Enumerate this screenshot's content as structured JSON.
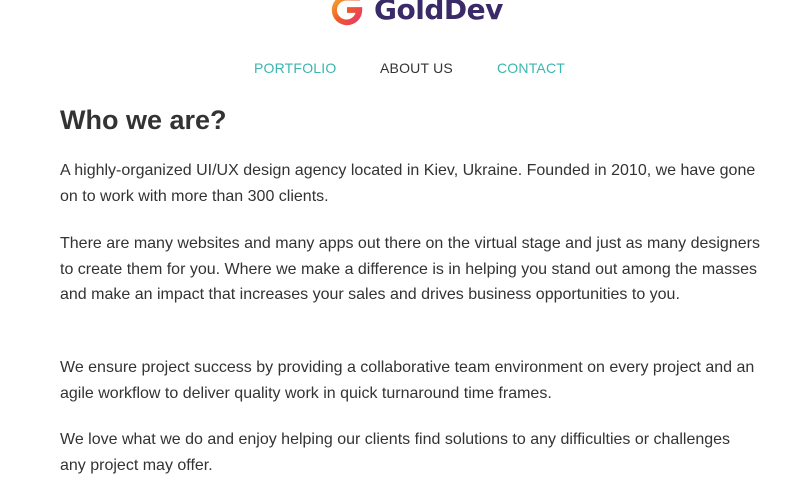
{
  "brand": {
    "name": "GoldDev",
    "logo_icon": "g-logo-mark-icon",
    "colors": {
      "logo_gradient_start": "#f05a28",
      "logo_gradient_mid": "#e8307a",
      "logo_gradient_end": "#f7b733",
      "logo_text": "#3b2a68"
    }
  },
  "nav": {
    "items": [
      {
        "label": "PORTFOLIO",
        "color": "#3bb5b0"
      },
      {
        "label": "ABOUT US",
        "color": "#333333"
      },
      {
        "label": "CONTACT",
        "color": "#3bb5b0"
      }
    ]
  },
  "main": {
    "title": "Who we are?",
    "paragraphs": [
      "A highly-organized UI/UX design agency located in Kiev, Ukraine. Founded in 2010, we have gone on to work with more than 300 clients.",
      "There are many websites and many apps out there on the virtual stage and just as many designers to create them for you. Where we make a difference is in helping you stand out among the masses and make an impact that increases your sales and drives business opportunities to you.",
      "We ensure project success by providing a collaborative team environment on every project and an agile workflow to deliver quality work in quick turnaround time frames.",
      "We love what we do and enjoy helping our clients find solutions to any difficulties or challenges any project may offer."
    ]
  }
}
